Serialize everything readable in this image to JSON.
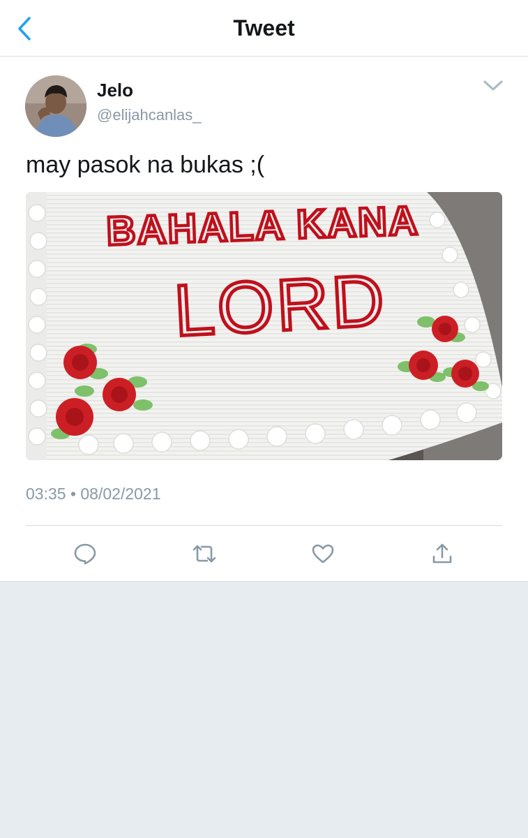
{
  "header": {
    "title": "Tweet",
    "back_icon": "chevron-left-icon",
    "accent_color": "#1da1f2"
  },
  "tweet": {
    "author": {
      "name": "Jelo",
      "handle": "@elijahcanlas_"
    },
    "text": "may pasok na bukas ;(",
    "media": {
      "cake_line1": "BAHALA KANA",
      "cake_line2": "LORD"
    },
    "timestamp": "03:35 • 08/02/2021",
    "actions": [
      {
        "icon": "reply-icon"
      },
      {
        "icon": "retweet-icon"
      },
      {
        "icon": "like-icon"
      },
      {
        "icon": "share-icon"
      }
    ]
  }
}
